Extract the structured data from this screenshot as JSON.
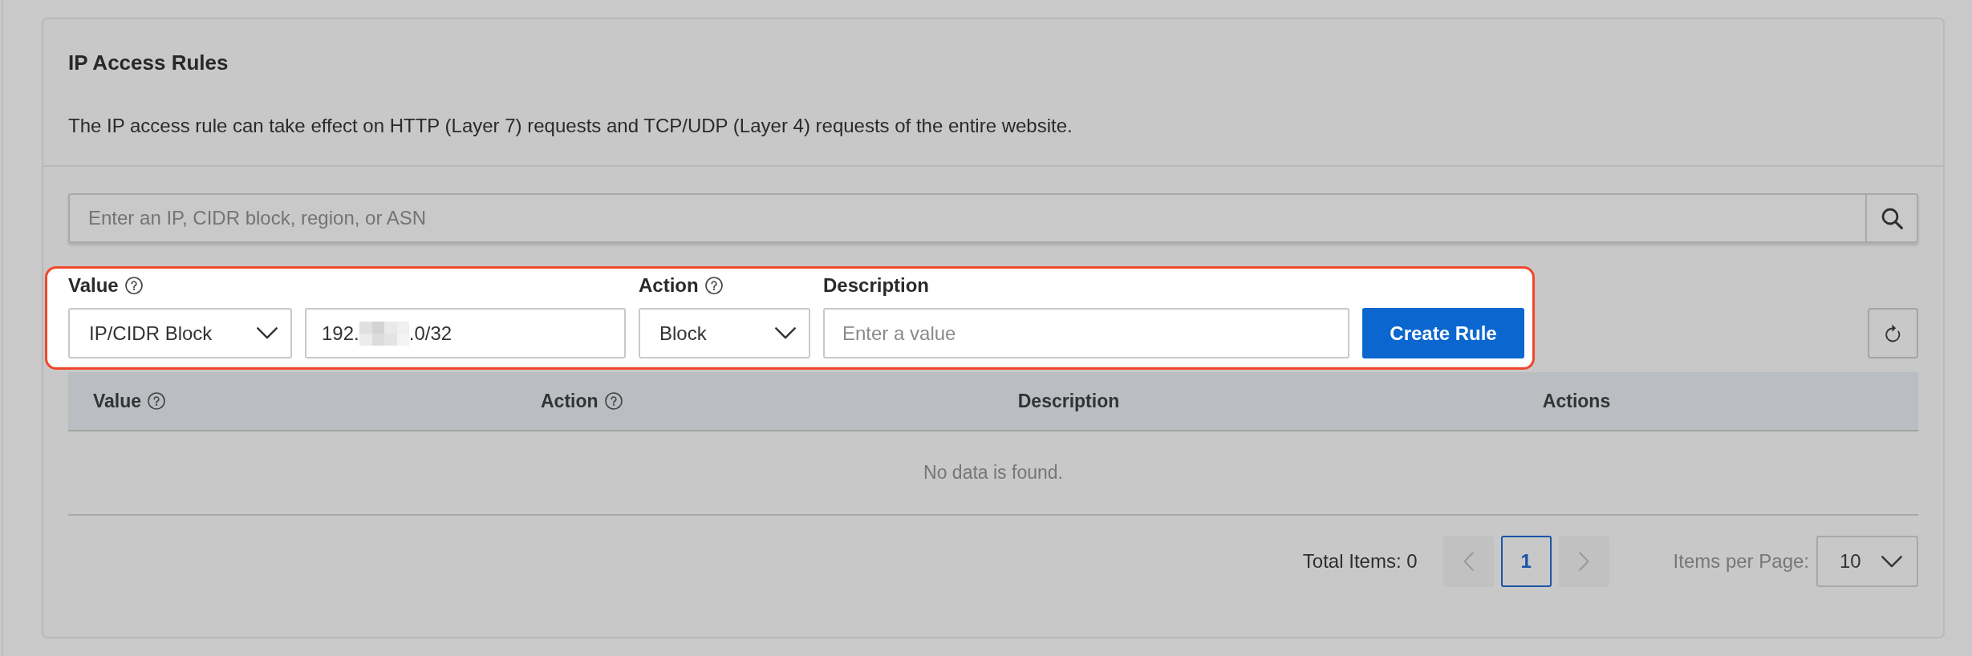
{
  "panel": {
    "title": "IP Access Rules",
    "description": "The IP access rule can take effect on HTTP (Layer 7) requests and TCP/UDP (Layer 4) requests of the entire website."
  },
  "search": {
    "placeholder": "Enter an IP, CIDR block, region, or ASN"
  },
  "rule_form": {
    "highlighted": true,
    "fields": [
      {
        "kind": "select",
        "label": "Value",
        "help": true,
        "value": "IP/CIDR Block"
      },
      {
        "kind": "input",
        "value_start": "192.",
        "redacted": true,
        "value_end": ".0/32"
      },
      {
        "kind": "select",
        "label": "Action",
        "help": true,
        "value": "Block"
      },
      {
        "kind": "input",
        "label": "Description",
        "placeholder": "Enter a value"
      }
    ],
    "create_button": "Create Rule"
  },
  "table": {
    "columns": [
      {
        "label": "Value",
        "help": true
      },
      {
        "label": "Action",
        "help": true
      },
      {
        "label": "Description"
      },
      {
        "label": "Actions"
      }
    ],
    "empty_text": "No data is found."
  },
  "pagination": {
    "total": "Total Items: 0",
    "prev": {
      "disabled": true
    },
    "pages": [
      {
        "label": "1",
        "selected": true
      }
    ],
    "next": {
      "disabled": true
    },
    "page_size_label": "Items per Page:",
    "page_size": "10"
  }
}
